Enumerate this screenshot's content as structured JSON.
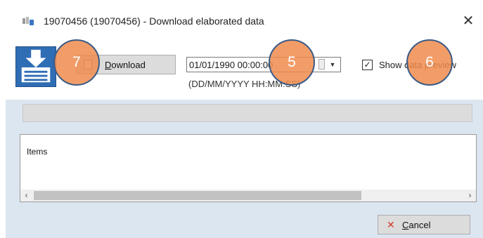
{
  "window": {
    "title": "19070456 (19070456) - Download elaborated data",
    "close_glyph": "✕"
  },
  "toolbar": {
    "download_label": "Download",
    "date_value": "01/01/1990 00:00:00",
    "date_dropdown_glyph": "▼",
    "date_format_hint": "(DD/MM/YYYY HH:MM:SS)",
    "show_preview_label": "Show data preview",
    "show_preview_checked": true,
    "check_glyph": "✓"
  },
  "items": {
    "label": "Items",
    "scroll_left_glyph": "‹",
    "scroll_right_glyph": "›"
  },
  "footer": {
    "cancel_label": "Cancel",
    "cancel_icon_glyph": "✕"
  },
  "callouts": {
    "c7": "7",
    "c5": "5",
    "c6": "6"
  },
  "icons": [
    "app-icon",
    "download-database-icon",
    "download-file-icon",
    "close-icon",
    "cancel-icon",
    "dropdown-arrow-icon",
    "check-icon"
  ],
  "colors": {
    "client_bg": "#dce6f1",
    "callout_fill": "#f08c4e",
    "callout_border": "#3b5b86",
    "big_icon_blue": "#2f6db5",
    "cancel_red": "#d03a2a"
  }
}
